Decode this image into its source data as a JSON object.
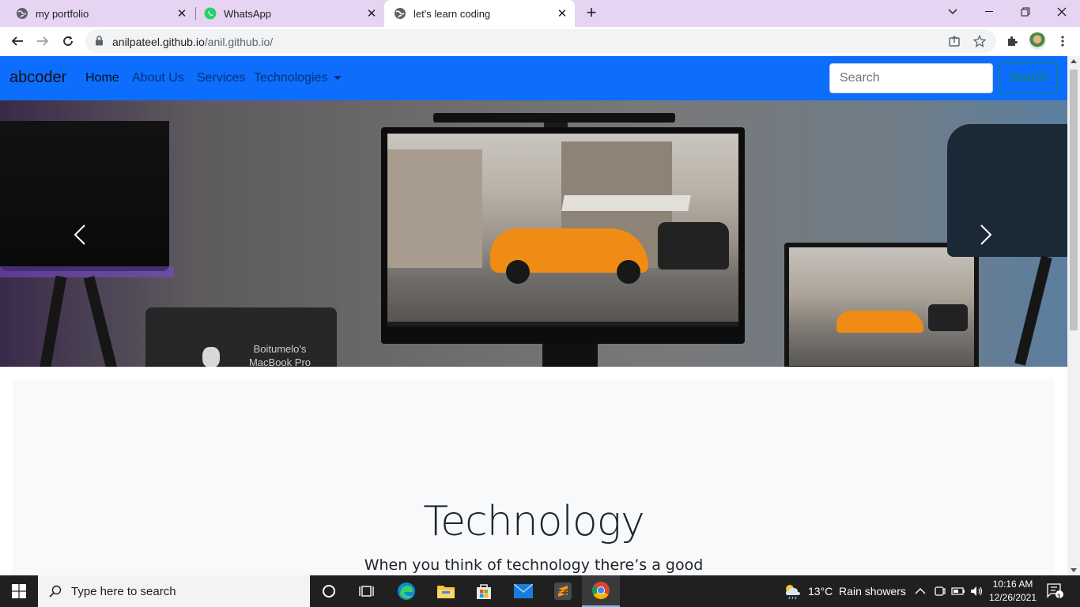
{
  "browser": {
    "tabs": [
      {
        "title": "my portfolio",
        "icon": "globe-icon",
        "active": false
      },
      {
        "title": "WhatsApp",
        "icon": "whatsapp-icon",
        "active": false
      },
      {
        "title": "let's learn coding",
        "icon": "globe-icon",
        "active": true
      }
    ],
    "url_host": "anilpateel.github.io",
    "url_path": "/anil.github.io/"
  },
  "site": {
    "brand": "abcoder",
    "nav": [
      {
        "label": "Home",
        "active": true
      },
      {
        "label": "About Us",
        "active": false
      },
      {
        "label": "Services",
        "active": false
      },
      {
        "label": "Technologies",
        "dropdown": true
      }
    ],
    "search_placeholder": "Search",
    "search_button": "Search",
    "navbar_color": "#0d6efd",
    "carousel": {
      "laptop_label_line1": "Boitumelo's",
      "laptop_label_line2": "MacBook Pro"
    },
    "hero": {
      "title": "Technology",
      "subtitle": "When you think of technology there’s a good"
    }
  },
  "taskbar": {
    "search_placeholder": "Type here to search",
    "weather": "13°C  Rain showers",
    "time": "10:16 AM",
    "date": "12/26/2021",
    "notification_count": "1"
  }
}
